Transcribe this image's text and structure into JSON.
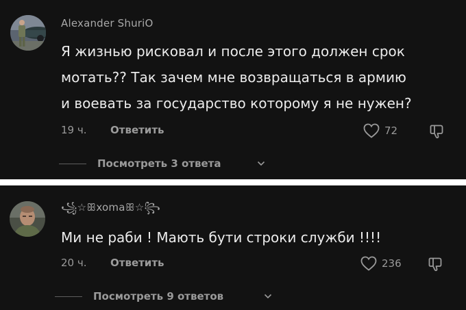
{
  "colors": {
    "background": "#121212",
    "separator": "#ffffff",
    "primary_text": "#ececec",
    "secondary_text": "#9a9a9a"
  },
  "comments": [
    {
      "username": "Alexander ShuriO",
      "avatar": "avatar-photo-man-by-car",
      "text": "Я жизнью рисковал и после этого должен срок\nмотать?? Так зачем мне возвращаться в армию\nи воевать за государство которому я не нужен?",
      "time": "19 ч.",
      "reply_label": "Ответить",
      "likes": "72",
      "view_replies_label": "Посмотреть 3 ответа",
      "icons": [
        "heart-outline-icon",
        "dislike-icon",
        "chevron-down-icon"
      ]
    },
    {
      "username": "꧁☆ꕥxomaꕥ☆꧂",
      "avatar": "avatar-photo-man-portrait",
      "text": "Ми не раби ! Мають бути строки служби !!!!",
      "time": "20 ч.",
      "reply_label": "Ответить",
      "likes": "236",
      "view_replies_label": "Посмотреть 9 ответов",
      "icons": [
        "heart-outline-icon",
        "dislike-icon",
        "chevron-down-icon"
      ]
    }
  ]
}
